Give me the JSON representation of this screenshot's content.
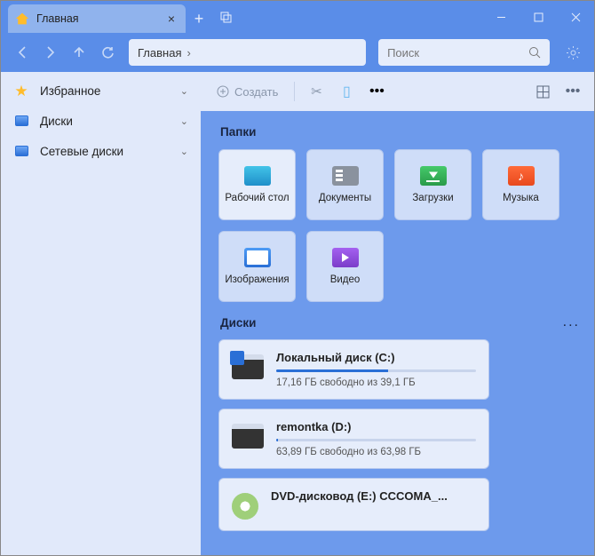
{
  "tab": {
    "title": "Главная",
    "close": "×",
    "add": "+"
  },
  "crumb": {
    "root": "Главная",
    "sep": "›"
  },
  "search": {
    "placeholder": "Поиск"
  },
  "sidebar": {
    "items": [
      {
        "label": "Избранное"
      },
      {
        "label": "Диски"
      },
      {
        "label": "Сетевые диски"
      }
    ]
  },
  "toolbar": {
    "create": "Создать",
    "more": "•••"
  },
  "sections": {
    "folders": "Папки",
    "disks": "Диски",
    "more": "..."
  },
  "folders": [
    {
      "label": "Рабочий стол"
    },
    {
      "label": "Документы"
    },
    {
      "label": "Загрузки"
    },
    {
      "label": "Музыка"
    },
    {
      "label": "Изображения"
    },
    {
      "label": "Видео"
    }
  ],
  "disks": [
    {
      "name": "Локальный диск (C:)",
      "free": "17,16 ГБ свободно из 39,1 ГБ",
      "pct": 56
    },
    {
      "name": "remontka (D:)",
      "free": "63,89 ГБ свободно из 63,98 ГБ",
      "pct": 1
    },
    {
      "name": "DVD-дисковод (E:) CCCOMA_...",
      "free": "",
      "pct": 0
    }
  ]
}
